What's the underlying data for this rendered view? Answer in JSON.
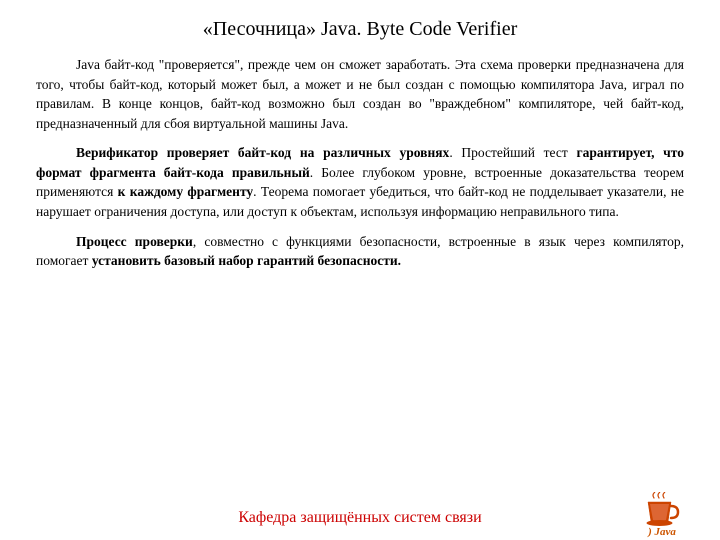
{
  "title": "«Песочница» Java. Byte Code Verifier",
  "paragraphs": [
    {
      "id": "p1",
      "indent": true,
      "text": "Java байт-код \"проверяется\", прежде чем он сможет заработать. Эта схема проверки предназначена для того, чтобы байт-код, который может был, а может и не был создан с помощью компилятора Java, играл по правилам. В конце концов, байт-код возможно был создан во \"враждебном\" компиляторе, чей байт-код, предназначенный для сбоя виртуальной машины Java."
    },
    {
      "id": "p2",
      "indent": true,
      "text_parts": [
        {
          "text": "Верификатор проверяет байт-код на различных уровнях",
          "bold": true
        },
        {
          "text": ". Простейший тест ",
          "bold": false
        },
        {
          "text": "гарантирует, что формат фрагмента байт-кода правильный",
          "bold": true
        },
        {
          "text": ". Более глубоком уровне, встроенные доказательства теорем применяются ",
          "bold": false
        },
        {
          "text": "к каждому фрагменту",
          "bold": true
        },
        {
          "text": ". Теорема помогает убедиться, что байт-код не подделывает указатели, не нарушает ограничения доступа, или доступ к объектам, используя информацию неправильного типа.",
          "bold": false
        }
      ]
    },
    {
      "id": "p3",
      "indent": true,
      "text_parts": [
        {
          "text": "Процесс проверки",
          "bold": true
        },
        {
          "text": ", совместно с функциями безопасности, встроенные в язык через компилятор, помогает ",
          "bold": false
        },
        {
          "text": "установить базовый набор гарантий безопасности.",
          "bold": true
        }
      ]
    }
  ],
  "footer": {
    "text": "Кафедра защищённых систем связи",
    "java_label": ") Java"
  }
}
